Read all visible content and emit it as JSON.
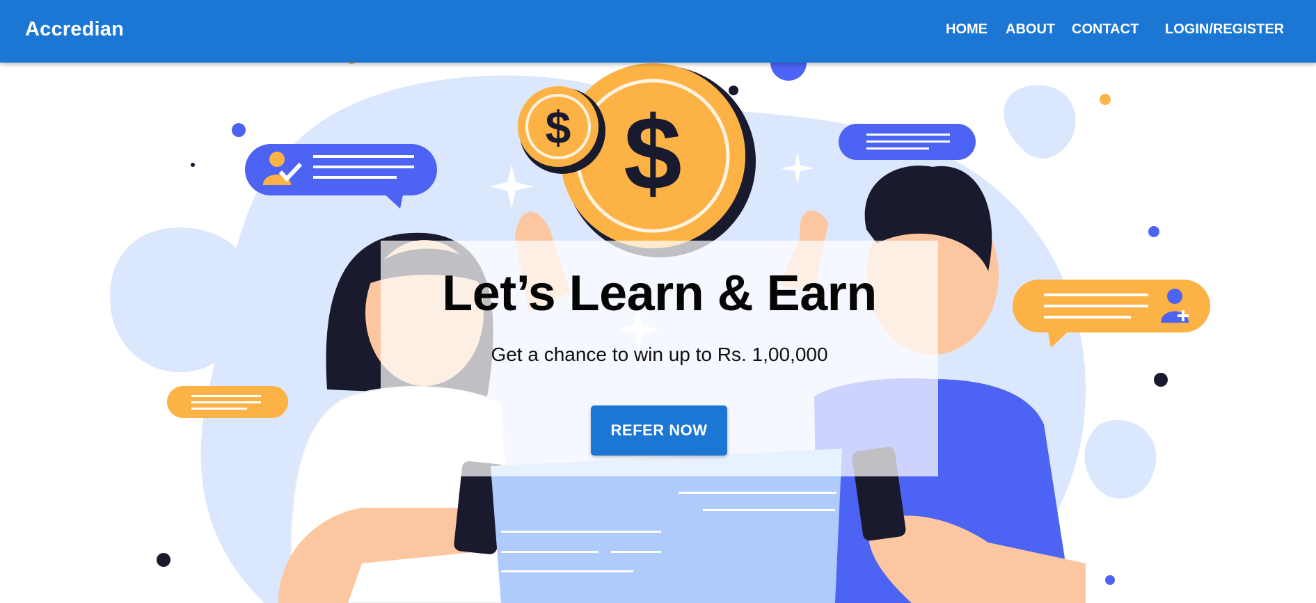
{
  "header": {
    "brand": "Accredian",
    "nav": [
      {
        "label": "HOME"
      },
      {
        "label": "ABOUT"
      },
      {
        "label": "CONTACT"
      },
      {
        "label": "LOGIN/REGISTER"
      }
    ]
  },
  "hero": {
    "title": "Let’s Learn & Earn",
    "subtitle": "Get a chance to win up to Rs. 1,00,000",
    "cta_label": "REFER NOW",
    "illustration_icons": [
      "coin-dollar-icon",
      "chat-bubble-icon",
      "add-user-icon",
      "verified-user-icon",
      "smartphone-icon"
    ]
  },
  "colors": {
    "primary": "#1b76d4",
    "coin": "#fdb245",
    "accent_blue": "#4d63f4",
    "blob": "#cfe0fd"
  }
}
